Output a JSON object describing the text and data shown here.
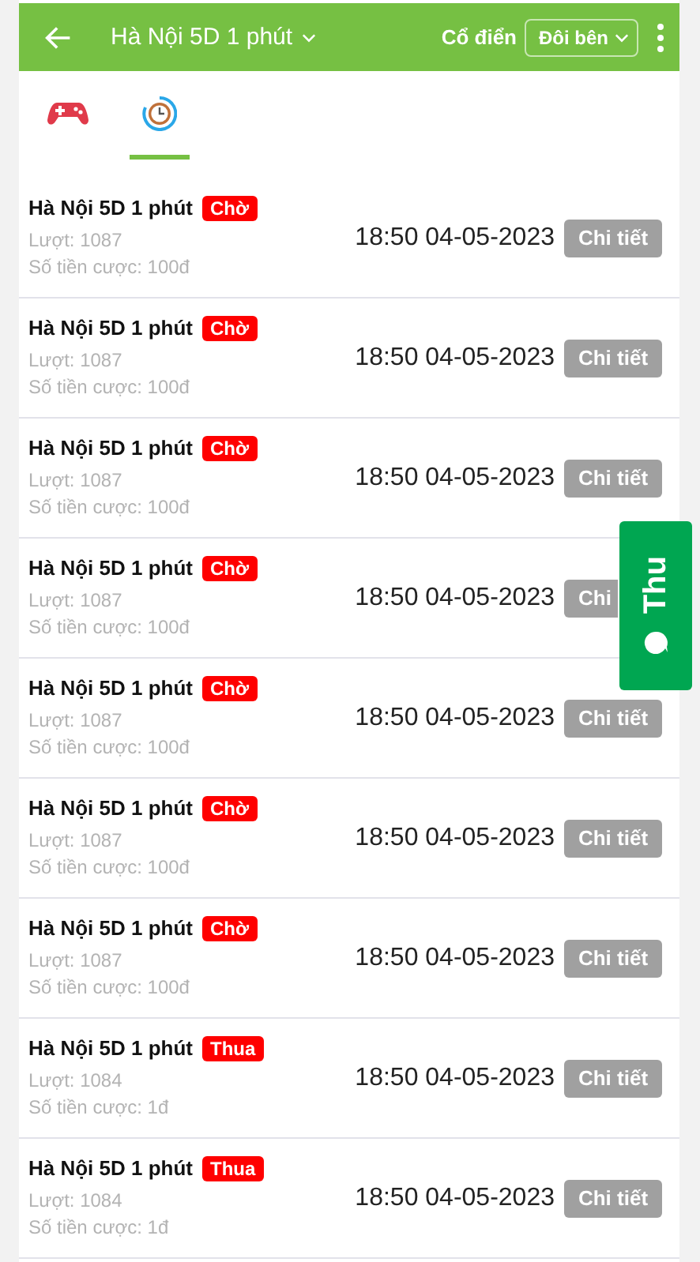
{
  "header": {
    "title": "Hà Nội 5D 1 phút",
    "mode_label": "Cổ điển",
    "mode_select": "Đôi bên"
  },
  "tabs": [
    {
      "kind": "gamepad",
      "selected": false
    },
    {
      "kind": "clock",
      "selected": true
    }
  ],
  "bets": [
    {
      "game": "Hà Nội 5D 1 phút",
      "status": "Chờ",
      "round": "Lượt: 1087",
      "amount": "Số tiền cược: 100đ",
      "time": "18:50 04-05-2023",
      "button": "Chi tiết"
    },
    {
      "game": "Hà Nội 5D 1 phút",
      "status": "Chờ",
      "round": "Lượt: 1087",
      "amount": "Số tiền cược: 100đ",
      "time": "18:50 04-05-2023",
      "button": "Chi tiết"
    },
    {
      "game": "Hà Nội 5D 1 phút",
      "status": "Chờ",
      "round": "Lượt: 1087",
      "amount": "Số tiền cược: 100đ",
      "time": "18:50 04-05-2023",
      "button": "Chi tiết"
    },
    {
      "game": "Hà Nội 5D 1 phút",
      "status": "Chờ",
      "round": "Lượt: 1087",
      "amount": "Số tiền cược: 100đ",
      "time": "18:50 04-05-2023",
      "button": "Chi",
      "covered": true
    },
    {
      "game": "Hà Nội 5D 1 phút",
      "status": "Chờ",
      "round": "Lượt: 1087",
      "amount": "Số tiền cược: 100đ",
      "time": "18:50 04-05-2023",
      "button": "Chi tiết"
    },
    {
      "game": "Hà Nội 5D 1 phút",
      "status": "Chờ",
      "round": "Lượt: 1087",
      "amount": "Số tiền cược: 100đ",
      "time": "18:50 04-05-2023",
      "button": "Chi tiết"
    },
    {
      "game": "Hà Nội 5D 1 phút",
      "status": "Chờ",
      "round": "Lượt: 1087",
      "amount": "Số tiền cược: 100đ",
      "time": "18:50 04-05-2023",
      "button": "Chi tiết"
    },
    {
      "game": "Hà Nội 5D 1 phút",
      "status": "Thua",
      "round": "Lượt: 1084",
      "amount": "Số tiền cược: 1đ",
      "time": "18:50 04-05-2023",
      "button": "Chi tiết"
    },
    {
      "game": "Hà Nội 5D 1 phút",
      "status": "Thua",
      "round": "Lượt: 1084",
      "amount": "Số tiền cược: 1đ",
      "time": "18:50 04-05-2023",
      "button": "Chi tiết"
    }
  ],
  "side_tab": {
    "label": "Thu"
  }
}
